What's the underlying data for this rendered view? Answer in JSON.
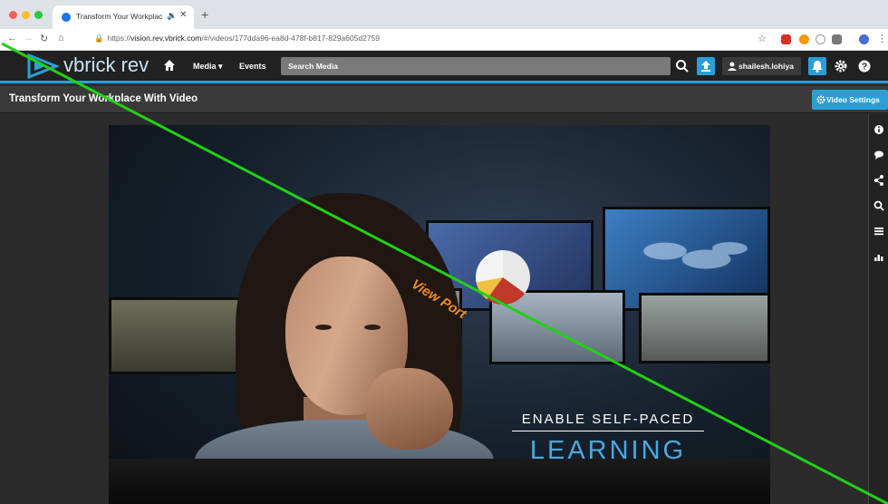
{
  "browser": {
    "tab_title": "Transform Your Workplace With Video",
    "tab_audio_icon": "speaker-icon",
    "url_prefix": "https://",
    "url_host": "vision.rev.vbrick.com",
    "url_path": "/#/videos/177dda96-ea8d-478f-b817-829a605d2759"
  },
  "header": {
    "logo_text": "vbrick rev",
    "nav_media": "Media ▾",
    "nav_events": "Events",
    "search_placeholder": "Search Media",
    "user_name": "shailesh.lohiya"
  },
  "video": {
    "title": "Transform Your Workplace With Video",
    "settings_label": "Video Settings",
    "overlay_line1": "ENABLE SELF-PACED",
    "overlay_line2": "LEARNING"
  },
  "annotation": {
    "label": "View Port",
    "line_color": "#22d116",
    "label_color": "#f08a1e"
  },
  "colors": {
    "accent": "#2a9fd6",
    "header_bg": "#212121",
    "titlebar_bg": "#3a3a3a"
  },
  "rail_icons": [
    "info-icon",
    "comment-icon",
    "share-icon",
    "search-icon",
    "list-icon",
    "analytics-icon"
  ]
}
